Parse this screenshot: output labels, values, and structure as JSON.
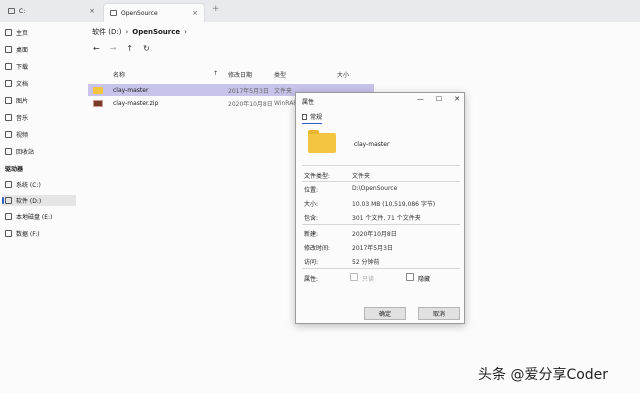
{
  "tabs": {
    "inactive": {
      "label": "C:"
    },
    "active": {
      "label": "OpenSource"
    },
    "close_glyph": "×",
    "new_tab_glyph": "+"
  },
  "breadcrumb": {
    "drive": "软件 (D:)",
    "folder": "OpenSource",
    "sep": "›"
  },
  "nav": {
    "back": "←",
    "forward": "→",
    "up": "↑",
    "refresh": "↻"
  },
  "sidebar": {
    "items": [
      {
        "label": "主页",
        "icon": "home-icon"
      },
      {
        "label": "桌面",
        "icon": "desktop-icon"
      },
      {
        "label": "下载",
        "icon": "download-icon"
      },
      {
        "label": "文档",
        "icon": "document-icon"
      },
      {
        "label": "图片",
        "icon": "picture-icon"
      },
      {
        "label": "音乐",
        "icon": "music-icon"
      },
      {
        "label": "视频",
        "icon": "video-icon"
      },
      {
        "label": "回收站",
        "icon": "recycle-bin-icon"
      }
    ],
    "section": "驱动器",
    "drives": [
      {
        "label": "系统 (C:)"
      },
      {
        "label": "软件 (D:)"
      },
      {
        "label": "本地磁盘 (E:)"
      },
      {
        "label": "数据 (F:)"
      }
    ]
  },
  "columns": {
    "name": "名称",
    "modified": "修改日期",
    "type": "类型",
    "size": "大小",
    "sort_glyph": "↑"
  },
  "files": [
    {
      "name": "clay-master",
      "date": "2017年5月3日",
      "type": "文件夹"
    },
    {
      "name": "clay-master.zip",
      "date": "2020年10月8日",
      "type": "WinRAR..."
    }
  ],
  "dialog": {
    "title": "属性",
    "controls": {
      "minimize": "—",
      "maximize": "☐",
      "close": "✕"
    },
    "tab": "常规",
    "name": "clay-master",
    "fields": {
      "type_label": "文件类型:",
      "type_value": "文件夹",
      "location_label": "位置:",
      "location_value": "D:\\OpenSource",
      "size_label": "大小:",
      "size_value": "10.03 MB (10,519,086 字节)",
      "contains_label": "包含:",
      "contains_value": "301 个文件, 71 个文件夹",
      "created_label": "新建:",
      "created_value": "2020年10月8日",
      "modified_label": "修改时间:",
      "modified_value": "2017年5月3日",
      "accessed_label": "访问:",
      "accessed_value": "52 分钟前",
      "attributes_label": "属性:",
      "readonly_label": "只读",
      "hidden_label": "隐藏"
    },
    "ok_label": "确定",
    "cancel_label": "取消"
  },
  "watermark": "头条 @爱分享Coder"
}
